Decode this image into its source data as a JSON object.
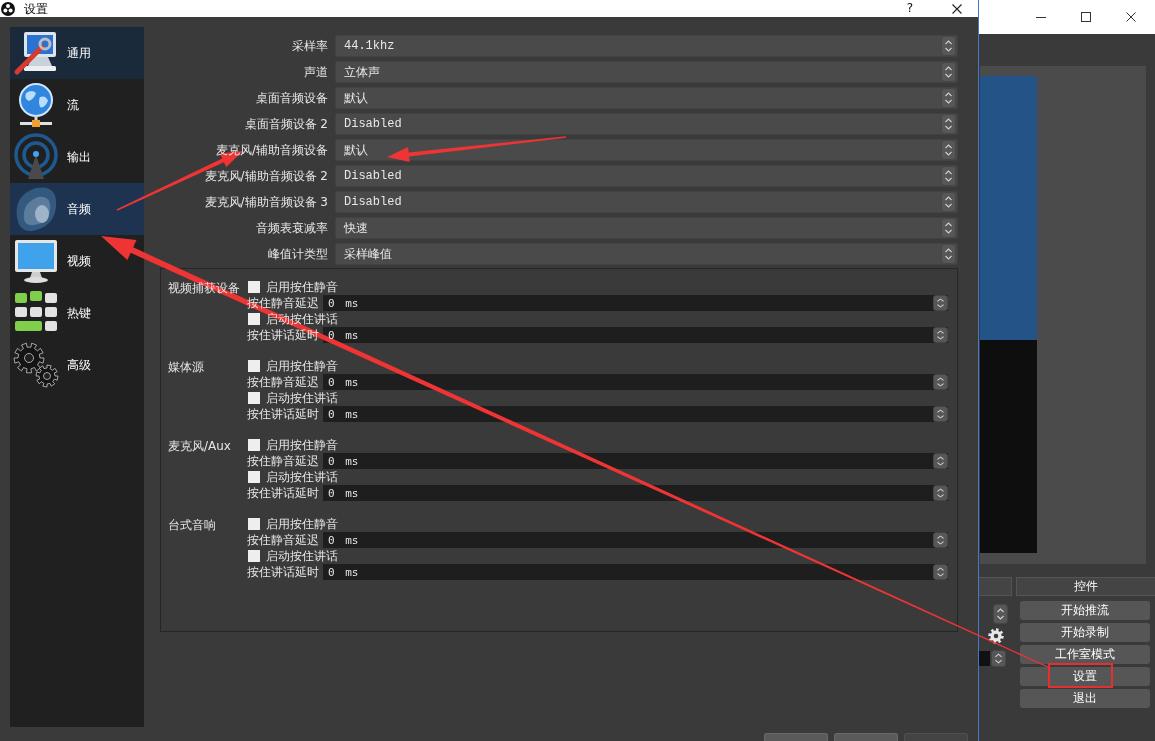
{
  "settings_dialog": {
    "title": "设置",
    "help_button": "?",
    "sidebar": {
      "items": [
        {
          "label": "通用",
          "selected": false,
          "hovered": true
        },
        {
          "label": "流",
          "selected": false,
          "hovered": false
        },
        {
          "label": "输出",
          "selected": false,
          "hovered": false
        },
        {
          "label": "音频",
          "selected": true,
          "hovered": false
        },
        {
          "label": "视频",
          "selected": false,
          "hovered": false
        },
        {
          "label": "热键",
          "selected": false,
          "hovered": false
        },
        {
          "label": "高级",
          "selected": false,
          "hovered": false
        }
      ]
    },
    "audio_fields": [
      {
        "label": "采样率",
        "value": "44.1khz"
      },
      {
        "label": "声道",
        "value": "立体声"
      },
      {
        "label": "桌面音频设备",
        "value": "默认"
      },
      {
        "label": "桌面音频设备 2",
        "value": "Disabled"
      },
      {
        "label": "麦克风/辅助音频设备",
        "value": "默认"
      },
      {
        "label": "麦克风/辅助音频设备 2",
        "value": "Disabled"
      },
      {
        "label": "麦克风/辅助音频设备 3",
        "value": "Disabled"
      },
      {
        "label": "音频表衰减率",
        "value": "快速"
      },
      {
        "label": "峰值计类型",
        "value": "采样峰值"
      }
    ],
    "hotkeys": [
      {
        "source": "视频捕获设备",
        "rows": [
          {
            "kind": "checkbox",
            "label": "启用按住静音",
            "checked": false
          },
          {
            "kind": "spinbox",
            "label": "按住静音延迟",
            "value": "0 ms"
          },
          {
            "kind": "checkbox",
            "label": "启动按住讲话",
            "checked": false
          },
          {
            "kind": "spinbox",
            "label": "按住讲话延时",
            "value": "0 ms"
          }
        ]
      },
      {
        "source": "媒体源",
        "rows": [
          {
            "kind": "checkbox",
            "label": "启用按住静音",
            "checked": false
          },
          {
            "kind": "spinbox",
            "label": "按住静音延迟",
            "value": "0 ms"
          },
          {
            "kind": "checkbox",
            "label": "启动按住讲话",
            "checked": false
          },
          {
            "kind": "spinbox",
            "label": "按住讲话延时",
            "value": "0 ms"
          }
        ]
      },
      {
        "source": "麦克风/Aux",
        "rows": [
          {
            "kind": "checkbox",
            "label": "启用按住静音",
            "checked": false
          },
          {
            "kind": "spinbox",
            "label": "按住静音延迟",
            "value": "0 ms"
          },
          {
            "kind": "checkbox",
            "label": "启动按住讲话",
            "checked": false
          },
          {
            "kind": "spinbox",
            "label": "按住讲话延时",
            "value": "0 ms"
          }
        ]
      },
      {
        "source": "台式音响",
        "rows": [
          {
            "kind": "checkbox",
            "label": "启用按住静音",
            "checked": false
          },
          {
            "kind": "spinbox",
            "label": "按住静音延迟",
            "value": "0 ms"
          },
          {
            "kind": "checkbox",
            "label": "启动按住讲话",
            "checked": false
          },
          {
            "kind": "spinbox",
            "label": "按住讲话延时",
            "value": "0 ms"
          }
        ]
      }
    ],
    "footer_buttons": [
      {
        "disabled": false
      },
      {
        "disabled": false
      },
      {
        "disabled": true
      }
    ]
  },
  "main_window": {
    "controls": {
      "title": "控件",
      "buttons": [
        "开始推流",
        "开始录制",
        "工作室模式",
        "设置",
        "退出"
      ]
    }
  }
}
